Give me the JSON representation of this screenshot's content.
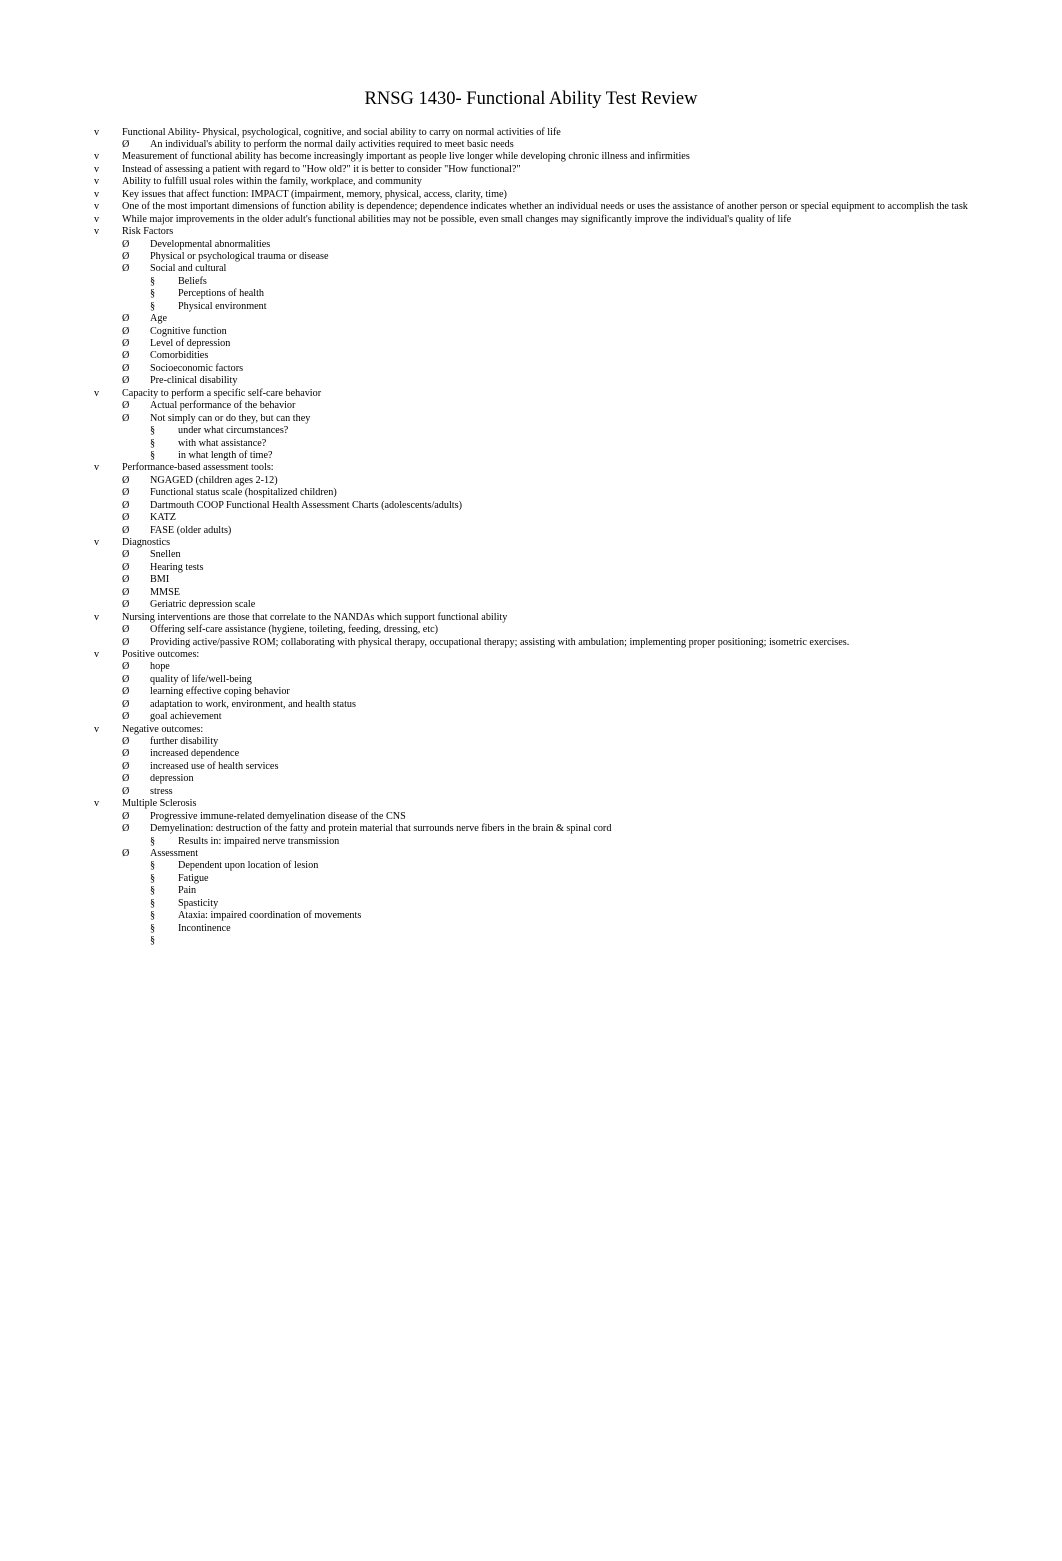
{
  "title": "RNSG 1430- Functional Ability Test Review",
  "bullets": {
    "lvl0": "v",
    "lvl1": "Ø",
    "lvl2": "§",
    "lvl3": "§"
  },
  "outline": [
    {
      "lvl": 0,
      "text": "Functional Ability- Physical, psychological, cognitive, and social ability to carry on normal activities of life"
    },
    {
      "lvl": 1,
      "text": "An individual's ability to perform the normal daily activities required to meet basic needs"
    },
    {
      "lvl": 0,
      "text": "Measurement of functional ability has become increasingly important as people live longer while developing chronic illness and infirmities"
    },
    {
      "lvl": 0,
      "text": "Instead of assessing a patient with regard to \"How old?\" it is better to consider \"How functional?\""
    },
    {
      "lvl": 0,
      "text": "Ability to fulfill usual roles within the family, workplace, and community"
    },
    {
      "lvl": 0,
      "text": "Key issues that affect function: IMPACT (impairment, memory, physical, access, clarity, time)"
    },
    {
      "lvl": 0,
      "text": "One of the most important dimensions of function ability is dependence; dependence indicates whether an individual needs or uses the assistance of another person or special equipment to accomplish the task"
    },
    {
      "lvl": 0,
      "text": "While major improvements in the older adult's functional abilities may not be possible, even small changes may significantly improve the individual's quality of life"
    },
    {
      "lvl": 0,
      "text": "Risk Factors"
    },
    {
      "lvl": 1,
      "text": "Developmental abnormalities"
    },
    {
      "lvl": 1,
      "text": "Physical or psychological trauma or disease"
    },
    {
      "lvl": 1,
      "text": "Social and cultural"
    },
    {
      "lvl": 2,
      "text": "Beliefs"
    },
    {
      "lvl": 2,
      "text": "Perceptions of health"
    },
    {
      "lvl": 2,
      "text": "Physical environment"
    },
    {
      "lvl": 1,
      "text": "Age"
    },
    {
      "lvl": 1,
      "text": "Cognitive function"
    },
    {
      "lvl": 1,
      "text": "Level of depression"
    },
    {
      "lvl": 1,
      "text": "Comorbidities"
    },
    {
      "lvl": 1,
      "text": "Socioeconomic factors"
    },
    {
      "lvl": 1,
      "text": "Pre-clinical disability"
    },
    {
      "lvl": 0,
      "text": "Capacity to perform a specific self-care behavior"
    },
    {
      "lvl": 1,
      "text": "Actual performance of the behavior"
    },
    {
      "lvl": 1,
      "text": "Not simply can or do they, but can they"
    },
    {
      "lvl": 2,
      "text": "under what circumstances?"
    },
    {
      "lvl": 2,
      "text": "with what assistance?"
    },
    {
      "lvl": 2,
      "text": "in what length of time?"
    },
    {
      "lvl": 0,
      "text": "Performance-based assessment tools:"
    },
    {
      "lvl": 1,
      "text": "NGAGED (children ages 2-12)"
    },
    {
      "lvl": 1,
      "text": "Functional status scale (hospitalized children)"
    },
    {
      "lvl": 1,
      "text": "Dartmouth COOP Functional Health Assessment Charts (adolescents/adults)"
    },
    {
      "lvl": 1,
      "text": "KATZ"
    },
    {
      "lvl": 1,
      "text": "FASE (older adults)"
    },
    {
      "lvl": 0,
      "text": "Diagnostics"
    },
    {
      "lvl": 1,
      "text": "Snellen"
    },
    {
      "lvl": 1,
      "text": "Hearing tests"
    },
    {
      "lvl": 1,
      "text": "BMI"
    },
    {
      "lvl": 1,
      "text": "MMSE"
    },
    {
      "lvl": 1,
      "text": "Geriatric depression scale"
    },
    {
      "lvl": 0,
      "text": "Nursing interventions are those that correlate to the NANDAs which support functional ability"
    },
    {
      "lvl": 1,
      "text": "Offering self-care assistance (hygiene, toileting, feeding, dressing, etc)"
    },
    {
      "lvl": 1,
      "text": "Providing active/passive ROM; collaborating with physical therapy, occupational therapy; assisting with ambulation; implementing proper positioning; isometric exercises."
    },
    {
      "lvl": 0,
      "text": "Positive outcomes:"
    },
    {
      "lvl": 1,
      "text": "hope"
    },
    {
      "lvl": 1,
      "text": "quality of life/well-being"
    },
    {
      "lvl": 1,
      "text": "learning effective coping behavior"
    },
    {
      "lvl": 1,
      "text": "adaptation to work, environment, and health status"
    },
    {
      "lvl": 1,
      "text": "goal achievement"
    },
    {
      "lvl": 0,
      "text": "Negative outcomes:"
    },
    {
      "lvl": 1,
      "text": "further disability"
    },
    {
      "lvl": 1,
      "text": "increased dependence"
    },
    {
      "lvl": 1,
      "text": "increased use of health services"
    },
    {
      "lvl": 1,
      "text": "depression"
    },
    {
      "lvl": 1,
      "text": "stress"
    },
    {
      "lvl": 0,
      "text": "Multiple Sclerosis"
    },
    {
      "lvl": 1,
      "text": "Progressive immune-related demyelination disease of the CNS"
    },
    {
      "lvl": 1,
      "text": "Demyelination: destruction of the fatty and protein material that surrounds nerve fibers in the brain & spinal cord"
    },
    {
      "lvl": 2,
      "text": "Results in: impaired nerve transmission"
    },
    {
      "lvl": 1,
      "text": "Assessment"
    },
    {
      "lvl": 2,
      "text": "Dependent upon location of lesion"
    },
    {
      "lvl": 2,
      "text": "Fatigue"
    },
    {
      "lvl": 2,
      "text": "Pain"
    },
    {
      "lvl": 2,
      "text": "Spasticity"
    },
    {
      "lvl": 2,
      "text": "Ataxia: impaired coordination of movements"
    },
    {
      "lvl": 2,
      "text": "Incontinence"
    },
    {
      "lvl": 2,
      "text": ""
    }
  ]
}
